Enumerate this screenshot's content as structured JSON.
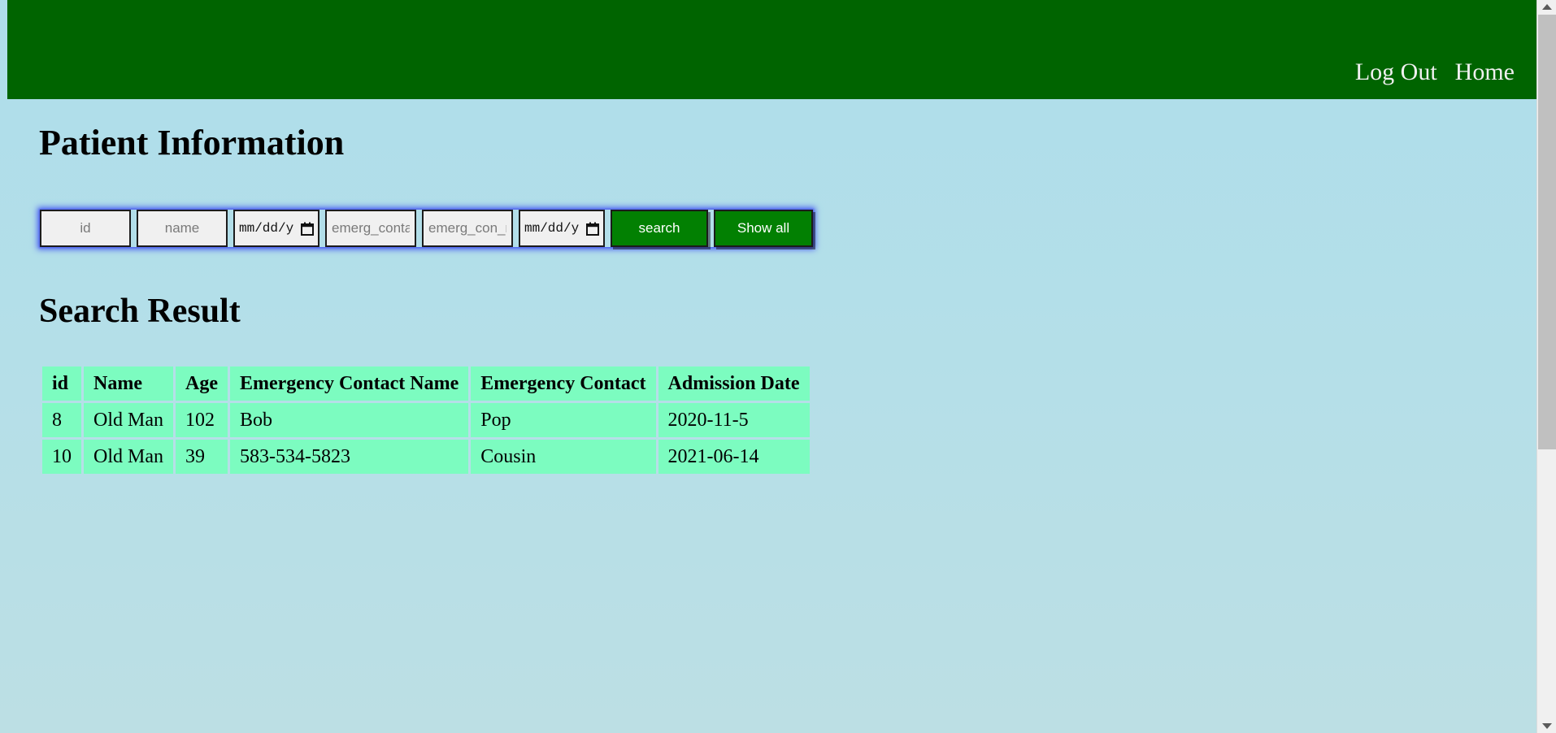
{
  "header": {
    "background_color": "#006400",
    "nav": [
      {
        "label": "Log Out",
        "name": "nav-log-out"
      },
      {
        "label": "Home",
        "name": "nav-home"
      }
    ]
  },
  "page": {
    "background_color": "#ade0e8",
    "title": "Patient Information",
    "results_title": "Search Result"
  },
  "search_form": {
    "fields": [
      {
        "name": "id-input",
        "type": "text",
        "placeholder": "id",
        "value": ""
      },
      {
        "name": "name-input",
        "type": "text",
        "placeholder": "name",
        "value": ""
      },
      {
        "name": "admission-date-input",
        "type": "date",
        "placeholder": "mm/dd/y",
        "value": ""
      },
      {
        "name": "emerg-contact-input",
        "type": "text",
        "placeholder": "emerg_contact",
        "value": ""
      },
      {
        "name": "emerg-con-name-input",
        "type": "text",
        "placeholder": "emerg_con_nam",
        "value": ""
      },
      {
        "name": "second-date-input",
        "type": "date",
        "placeholder": "mm/dd/y",
        "value": ""
      }
    ],
    "buttons": [
      {
        "name": "search-button",
        "label": "search",
        "color": "#028002"
      },
      {
        "name": "show-all-button",
        "label": "Show all",
        "color": "#028002"
      }
    ],
    "focus_glow_color": "#4d62f0",
    "calendar_icon": "calendar-icon"
  },
  "table": {
    "cell_color": "#7cfcc0",
    "columns": [
      "id",
      "Name",
      "Age",
      "Emergency Contact Name",
      "Emergency Contact",
      "Admission Date"
    ],
    "rows": [
      {
        "id": "8",
        "name": "Old Man",
        "age": "102",
        "emergency_contact_name": "Bob",
        "emergency_contact": "Pop",
        "admission_date": "2020-11-5"
      },
      {
        "id": "10",
        "name": "Old Man",
        "age": "39",
        "emergency_contact_name": "583-534-5823",
        "emergency_contact": "Cousin",
        "admission_date": "2021-06-14"
      }
    ]
  },
  "scrollbar": {
    "up_arrow": "chevron-up-icon",
    "down_arrow": "chevron-down-icon"
  }
}
